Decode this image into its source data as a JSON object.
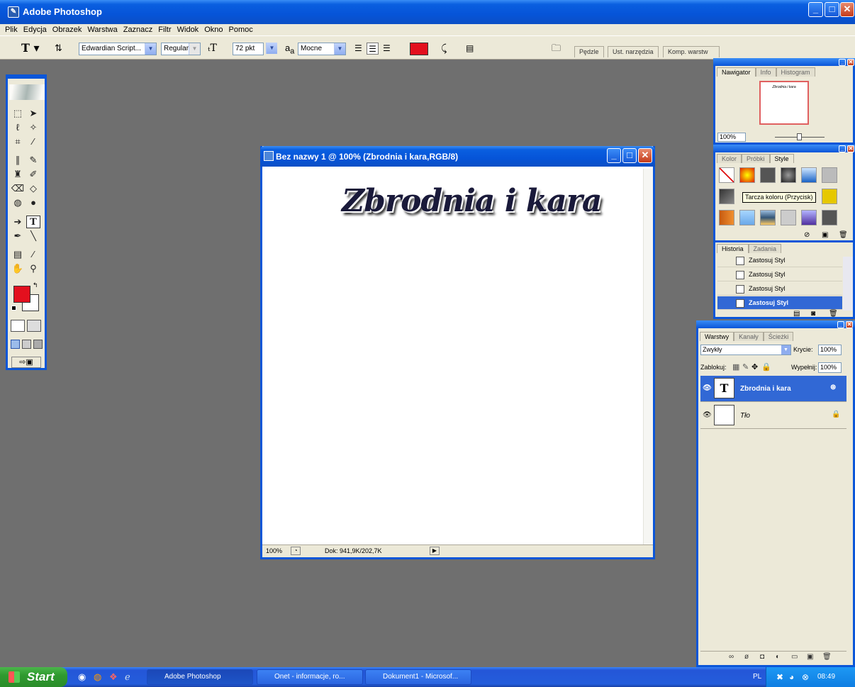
{
  "app": {
    "title": "Adobe Photoshop"
  },
  "menu": [
    "Plik",
    "Edycja",
    "Obrazek",
    "Warstwa",
    "Zaznacz",
    "Filtr",
    "Widok",
    "Okno",
    "Pomoc"
  ],
  "options": {
    "font_family": "Edwardian Script...",
    "font_style": "Regular",
    "font_size": "72 pkt",
    "aa_label": "a",
    "antialias": "Mocne",
    "text_color": "#e3101e"
  },
  "dock_tabs": [
    "Pędzle",
    "Ust. narzędzia",
    "Komp. warstw"
  ],
  "document": {
    "title": "Bez nazwy 1 @ 100% (Zbrodnia i kara,RGB/8)",
    "text": "Zbrodnia i kara",
    "zoom": "100%",
    "doc_info": "Dok: 941,9K/202,7K"
  },
  "navigator": {
    "tabs": [
      "Nawigator",
      "Info",
      "Histogram"
    ],
    "zoom": "100%",
    "thumb_text": "Zbrodnia i kara"
  },
  "styles": {
    "tabs": [
      "Kolor",
      "Próbki",
      "Style"
    ],
    "tooltip": "Tarcza koloru (Przycisk)"
  },
  "history": {
    "tabs": [
      "Historia",
      "Zadania"
    ],
    "items": [
      "Zastosuj Styl",
      "Zastosuj Styl",
      "Zastosuj Styl",
      "Zastosuj Styl"
    ]
  },
  "layers": {
    "tabs": [
      "Warstwy",
      "Kanały",
      "Ścieżki"
    ],
    "blend_mode": "Zwykły",
    "opacity_label": "Krycie:",
    "opacity": "100%",
    "lock_label": "Zablokuj:",
    "fill_label": "Wypełnij:",
    "fill": "100%",
    "items": [
      {
        "name": "Zbrodnia i kara",
        "thumb": "T"
      },
      {
        "name": "Tło",
        "thumb": ""
      }
    ]
  },
  "toolbox": {
    "foreground": "#e3101e",
    "background": "#ffffff"
  },
  "taskbar": {
    "start": "Start",
    "buttons": [
      "Adobe Photoshop",
      "Onet - informacje, ro...",
      "Dokument1 - Microsof..."
    ],
    "lang": "PL",
    "time": "08:49"
  }
}
